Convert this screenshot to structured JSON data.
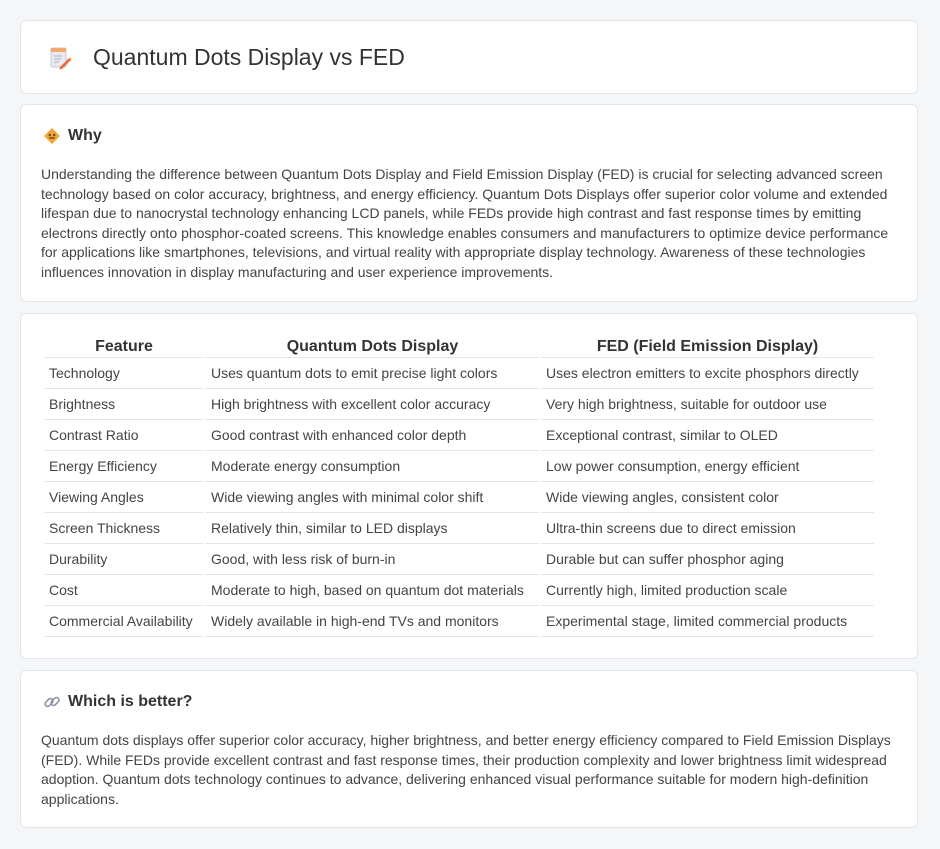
{
  "header": {
    "title": "Quantum Dots Display vs FED",
    "icon": "document-pencil-icon"
  },
  "why": {
    "title": "Why",
    "icon": "diamond-sign-icon",
    "text": "Understanding the difference between Quantum Dots Display and Field Emission Display (FED) is crucial for selecting advanced screen technology based on color accuracy, brightness, and energy efficiency. Quantum Dots Displays offer superior color volume and extended lifespan due to nanocrystal technology enhancing LCD panels, while FEDs provide high contrast and fast response times by emitting electrons directly onto phosphor-coated screens. This knowledge enables consumers and manufacturers to optimize device performance for applications like smartphones, televisions, and virtual reality with appropriate display technology. Awareness of these technologies influences innovation in display manufacturing and user experience improvements."
  },
  "table": {
    "headers": [
      "Feature",
      "Quantum Dots Display",
      "FED (Field Emission Display)"
    ],
    "rows": [
      [
        "Technology",
        "Uses quantum dots to emit precise light colors",
        "Uses electron emitters to excite phosphors directly"
      ],
      [
        "Brightness",
        "High brightness with excellent color accuracy",
        "Very high brightness, suitable for outdoor use"
      ],
      [
        "Contrast Ratio",
        "Good contrast with enhanced color depth",
        "Exceptional contrast, similar to OLED"
      ],
      [
        "Energy Efficiency",
        "Moderate energy consumption",
        "Low power consumption, energy efficient"
      ],
      [
        "Viewing Angles",
        "Wide viewing angles with minimal color shift",
        "Wide viewing angles, consistent color"
      ],
      [
        "Screen Thickness",
        "Relatively thin, similar to LED displays",
        "Ultra-thin screens due to direct emission"
      ],
      [
        "Durability",
        "Good, with less risk of burn-in",
        "Durable but can suffer phosphor aging"
      ],
      [
        "Cost",
        "Moderate to high, based on quantum dot materials",
        "Currently high, limited production scale"
      ],
      [
        "Commercial Availability",
        "Widely available in high-end TVs and monitors",
        "Experimental stage, limited commercial products"
      ]
    ]
  },
  "better": {
    "title": "Which is better?",
    "icon": "link-icon",
    "text": "Quantum dots displays offer superior color accuracy, higher brightness, and better energy efficiency compared to Field Emission Displays (FED). While FEDs provide excellent contrast and fast response times, their production complexity and lower brightness limit widespread adoption. Quantum dots technology continues to advance, delivering enhanced visual performance suitable for modern high-definition applications."
  }
}
